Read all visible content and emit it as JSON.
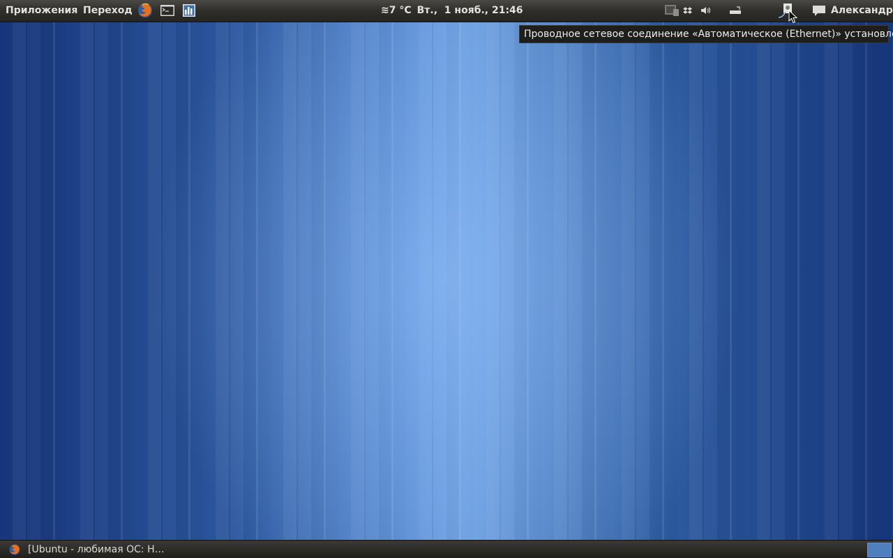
{
  "top_panel": {
    "menus": {
      "applications": "Приложения",
      "places": "Переход"
    },
    "launchers": [
      "firefox-icon",
      "terminal-icon",
      "system-monitor-icon"
    ],
    "weather": "≋7 °C",
    "datetime": "Вт.,  1 нояб., 21:46",
    "tray_icons": [
      "display-icon",
      "dropbox-icon",
      "volume-icon",
      "keyboard-icon",
      "network-wired-icon"
    ],
    "messaging_icon": "speech-bubble-icon",
    "user": "Александр"
  },
  "tooltip": {
    "text": "Проводное сетевое соединение «Автоматическое (Ethernet)» установлено"
  },
  "bottom_panel": {
    "window_title": "[Ubuntu - любимая ОС: Н…",
    "window_icon": "firefox-icon"
  },
  "colors": {
    "panel": "#2f2e2b",
    "wallpaper_dark": "#17357a",
    "wallpaper_light": "#6ea0e0",
    "workspace_active": "#4f7fbf"
  }
}
